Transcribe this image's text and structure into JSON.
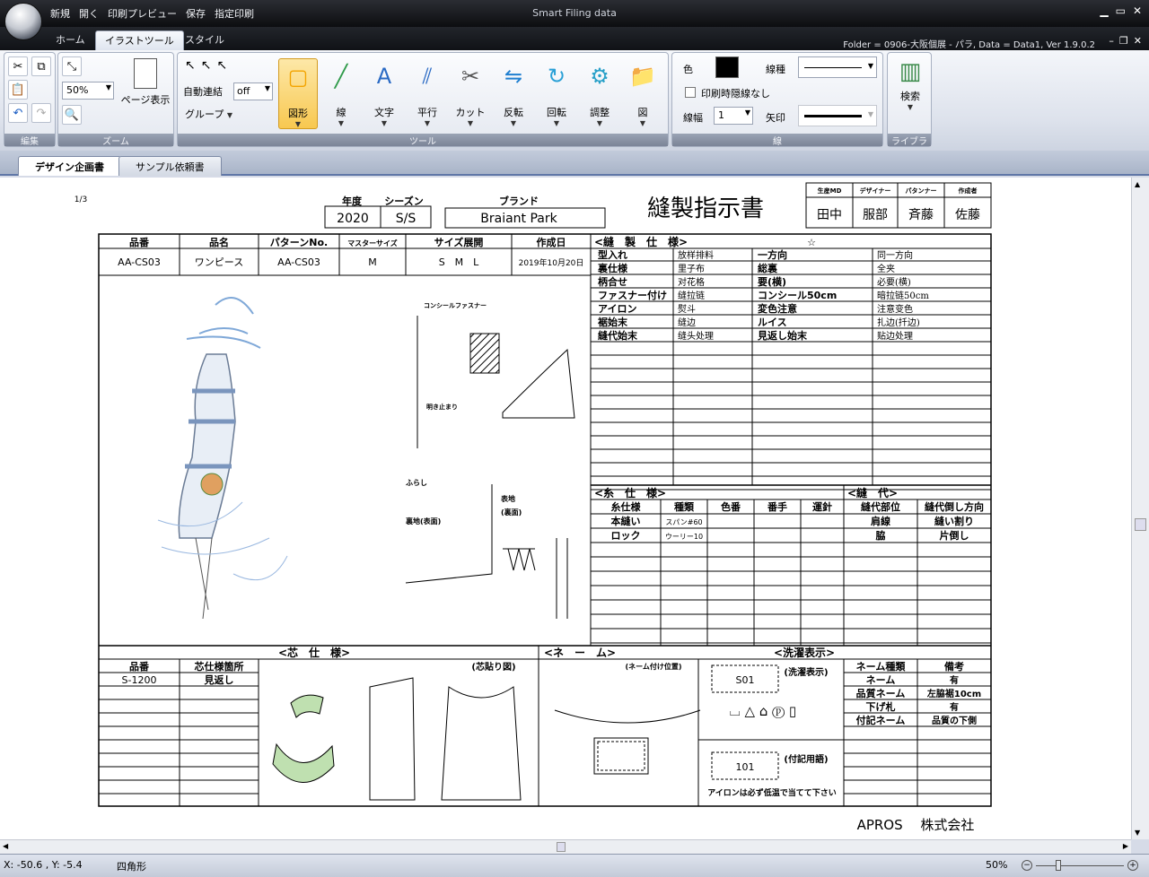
{
  "app": {
    "title": "Smart Filing data",
    "folder_info": "Folder = 0906-大阪個展 - パラ, Data = Data1, Ver 1.9.0.2"
  },
  "quickmenu": [
    "新規",
    "開く",
    "印刷プレビュー",
    "保存",
    "指定印刷"
  ],
  "ribbon_tabs": [
    "ホーム",
    "イラストツール",
    "スタイル"
  ],
  "ribbon": {
    "groups": {
      "edit": "編集",
      "zoom": "ズーム",
      "tools": "ツール",
      "line": "線",
      "library": "ライブラリ"
    },
    "zoom_value": "50%",
    "page_display": "ページ表示",
    "auto_connect": "自動連結",
    "auto_connect_value": "off",
    "group_label": "グループ",
    "tools": [
      "図形",
      "線",
      "文字",
      "平行",
      "カット",
      "反転",
      "回転",
      "調整",
      "図"
    ],
    "color_label": "色",
    "color_value": "#000000",
    "line_type_label": "線種",
    "print_hide_label": "印刷時隠線なし",
    "line_width_label": "線幅",
    "line_width_value": "1",
    "arrow_label": "矢印",
    "search_label": "検索"
  },
  "doc_tabs": [
    "デザイン企画書",
    "サンプル依頼書"
  ],
  "doc": {
    "page_num": "1/3",
    "year_label": "年度",
    "season_label": "シーズン",
    "year": "2020",
    "season": "S/S",
    "brand_label": "ブランド",
    "brand": "Braiant Park",
    "title": "縫製指示書",
    "approvals": {
      "labels": [
        "生産MD",
        "デザイナー",
        "パタンナー",
        "作成者"
      ],
      "names": [
        "田中",
        "服部",
        "斉藤",
        "佐藤"
      ]
    },
    "info_headers": [
      "品番",
      "品名",
      "パターンNo.",
      "マスターサイズ",
      "サイズ展開",
      "作成日"
    ],
    "info_values": [
      "AA-CS03",
      "ワンピース",
      "AA-CS03",
      "M",
      "S　M　L",
      "2019年10月20日"
    ],
    "sewing_header": "<縫　製　仕　様>",
    "star": "☆",
    "sewing_rows": [
      [
        "型入れ",
        "放样排料",
        "一方向",
        "同一方向"
      ],
      [
        "裏仕様",
        "里子布",
        "総裏",
        "全夹"
      ],
      [
        "柄合せ",
        "对花格",
        "要(横)",
        "必要(横)"
      ],
      [
        "ファスナー付け",
        "缝拉链",
        "コンシール50cm",
        "暗拉链50cm"
      ],
      [
        "アイロン",
        "熨斗",
        "変色注意",
        "注意变色"
      ],
      [
        "裾始末",
        "缝边",
        "ルイス",
        "扎边(扦边)"
      ],
      [
        "縫代始末",
        "缝头处理",
        "見返し始末",
        "贴边处理"
      ]
    ],
    "sketch_labels": {
      "concealed": "コンシールファスナー",
      "opening": "明き止まり",
      "furashi": "ふらし",
      "omote": "表地\n(裏面)",
      "ura": "裏地(表面)"
    },
    "thread_header": "<糸　仕　様>",
    "thread_cols": [
      "糸仕様",
      "種類",
      "色番",
      "番手",
      "運針"
    ],
    "thread_rows": [
      [
        "本縫い",
        "スパン#60",
        "",
        "",
        ""
      ],
      [
        "ロック",
        "ウーリー10",
        "",
        "",
        ""
      ]
    ],
    "seam_header": "<縫　代>",
    "seam_cols": [
      "縫代部位",
      "縫代倒し方向"
    ],
    "seam_rows": [
      [
        "肩線",
        "縫い割り"
      ],
      [
        "脇",
        "片倒し"
      ]
    ],
    "interlining_header": "<芯　仕　様>",
    "interlining_cols": [
      "品番",
      "芯仕様箇所"
    ],
    "interlining_rows": [
      [
        "S-1200",
        "見返し"
      ]
    ],
    "interlining_diagram": "(芯貼り図)",
    "label_header": "<ネ　ー　ム>",
    "label_position": "(ネーム付け位置)",
    "care_header": "<洗濯表示>",
    "care_code": "S01",
    "care_label": "(洗濯表示)",
    "note_code": "101",
    "note_label": "(付記用語)",
    "note_text": "アイロンは必ず低温で当てて下さい",
    "name_cols": [
      "ネーム種類",
      "備考"
    ],
    "name_rows": [
      [
        "ネーム",
        "有"
      ],
      [
        "品質ネーム",
        "左脇裾10cm"
      ],
      [
        "下げ札",
        "有"
      ],
      [
        "付記ネーム",
        "品質の下側"
      ]
    ],
    "company": "APROS　 株式会社"
  },
  "status": {
    "coords": "X: -50.6 , Y: -5.4",
    "shape": "四角形",
    "zoom": "50%"
  }
}
